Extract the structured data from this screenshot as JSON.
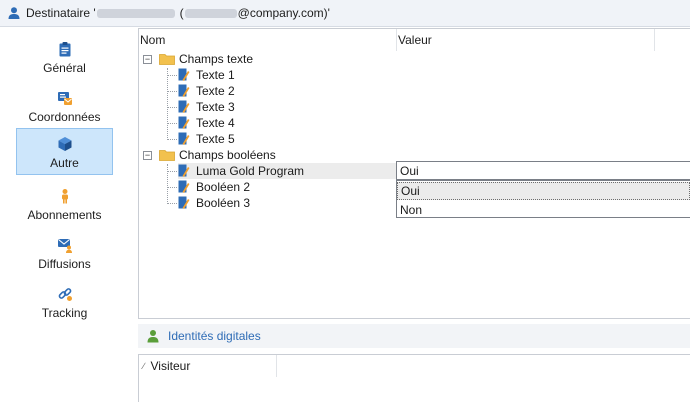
{
  "titlebar": {
    "prefix": "Destinataire '",
    "open_paren": "(",
    "email_suffix": "@company.com)'"
  },
  "sidebar": {
    "items": [
      {
        "label": "Général",
        "icon": "clipboard-icon"
      },
      {
        "label": "Coordonnées",
        "icon": "contact-card-icon"
      },
      {
        "label": "Autre",
        "icon": "cube-icon",
        "active": true
      },
      {
        "label": "Abonnements",
        "icon": "person-icon"
      },
      {
        "label": "Diffusions",
        "icon": "mail-person-icon"
      },
      {
        "label": "Tracking",
        "icon": "link-icon"
      }
    ]
  },
  "tree": {
    "columns": [
      "Nom",
      "Valeur"
    ],
    "groups": [
      {
        "label": "Champs texte",
        "expanded": true,
        "items": [
          "Texte 1",
          "Texte 2",
          "Texte 3",
          "Texte 4",
          "Texte 5"
        ]
      },
      {
        "label": "Champs booléens",
        "expanded": true,
        "items": [
          "Luma Gold Program",
          "Booléen 2",
          "Booléen 3"
        ]
      }
    ],
    "selected_item": "Luma Gold Program",
    "editor": {
      "value": "Oui",
      "options": [
        "Oui",
        "Non"
      ],
      "highlighted": "Oui"
    }
  },
  "identities": {
    "title": "Identités digitales",
    "column": "Visiteur"
  },
  "colors": {
    "accent_blue": "#2e6cb6",
    "active_bg": "#cde6fb",
    "folder": "#f2c14e",
    "icon_orange": "#f0a030"
  }
}
